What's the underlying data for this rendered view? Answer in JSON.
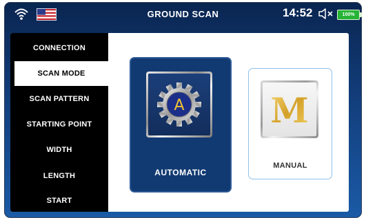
{
  "status_bar": {
    "title": "GROUND SCAN",
    "time": "14:52",
    "battery_text": "100%",
    "icons": [
      "wifi-icon",
      "us-flag-icon",
      "speaker-muted-icon",
      "battery-icon"
    ]
  },
  "sidebar": {
    "items": [
      {
        "label": "CONNECTION",
        "active": false
      },
      {
        "label": "SCAN MODE",
        "active": true
      },
      {
        "label": "SCAN PATTERN",
        "active": false
      },
      {
        "label": "STARTING POINT",
        "active": false
      },
      {
        "label": "WIDTH",
        "active": false
      },
      {
        "label": "LENGTH",
        "active": false
      },
      {
        "label": "START",
        "active": false
      }
    ]
  },
  "modes": {
    "automatic": {
      "label": "AUTOMATIC",
      "icon": "automatic-gear-icon",
      "icon_letter": "A",
      "selected": true
    },
    "manual": {
      "label": "MANUAL",
      "icon": "manual-m-icon",
      "icon_letter": "M",
      "selected": false
    }
  },
  "colors": {
    "accent_blue": "#123a72",
    "battery_green": "#27b436",
    "gold": "#e2b93b"
  }
}
